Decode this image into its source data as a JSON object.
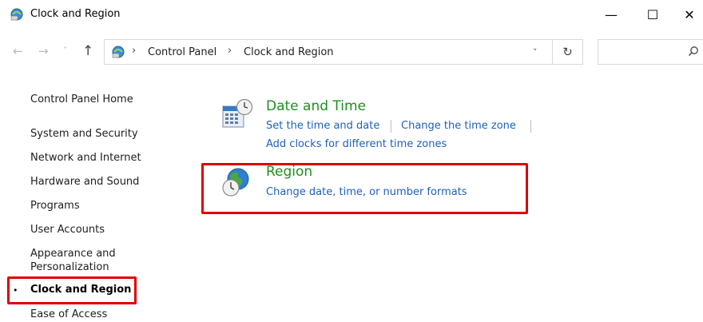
{
  "window": {
    "title": "Clock and Region",
    "minimize_glyph": "—",
    "maximize_glyph": "☐",
    "close_glyph": "✕"
  },
  "nav": {
    "back_glyph": "←",
    "forward_glyph": "→",
    "recent_glyph": "˅",
    "up_glyph": "↑",
    "separator_glyph": "›",
    "breadcrumbs": [
      "Control Panel",
      "Clock and Region"
    ],
    "dropdown_glyph": "˅",
    "refresh_glyph": "↻",
    "search_placeholder": ""
  },
  "sidebar": {
    "home": "Control Panel Home",
    "items": [
      "System and Security",
      "Network and Internet",
      "Hardware and Sound",
      "Programs",
      "User Accounts",
      "Appearance and Personalization",
      "Clock and Region",
      "Ease of Access"
    ],
    "active_index": 6,
    "bullet_glyph": "•"
  },
  "categories": [
    {
      "title": "Date and Time",
      "icon": "calendar-clock-icon",
      "links": [
        "Set the time and date",
        "Change the time zone",
        "Add clocks for different time zones"
      ]
    },
    {
      "title": "Region",
      "icon": "globe-clock-icon",
      "links": [
        "Change date, time, or number formats"
      ]
    }
  ],
  "colors": {
    "category_title": "#1e8f1e",
    "link": "#1f5fbf",
    "highlight_box": "#e00000"
  }
}
